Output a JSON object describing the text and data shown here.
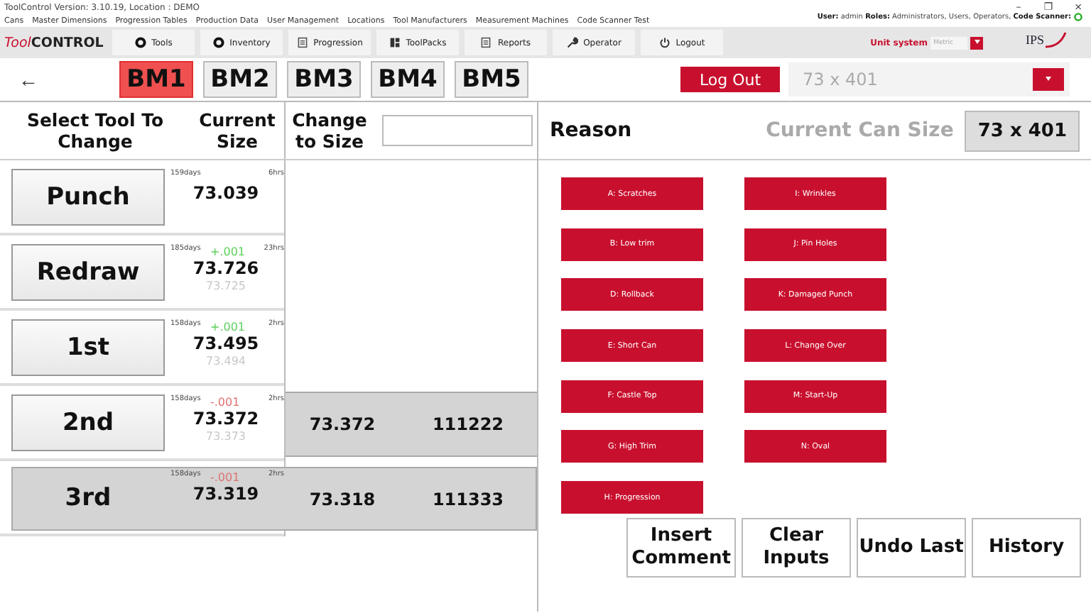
{
  "window": {
    "title": "ToolControl Version: 3.10.19, Location : DEMO",
    "controls": [
      "–",
      "❐",
      "×"
    ]
  },
  "menu": [
    "Cans",
    "Master Dimensions",
    "Progression Tables",
    "Production Data",
    "User Management",
    "Locations",
    "Tool Manufacturers",
    "Measurement Machines",
    "Code Scanner Test"
  ],
  "logo": {
    "text_light": "Tool",
    "text_bold": "CONTROL"
  },
  "toolbar": [
    {
      "label": "Tools",
      "kind": "circle"
    },
    {
      "label": "Inventory",
      "kind": "circle"
    },
    {
      "label": "Progression",
      "kind": "doc"
    },
    {
      "label": "ToolPacks",
      "kind": "pack"
    },
    {
      "label": "Reports",
      "kind": "doc"
    },
    {
      "label": "Operator",
      "kind": "wrench"
    },
    {
      "label": "Logout",
      "kind": "logout"
    }
  ],
  "user_info": {
    "user_label": "User:",
    "user": "admin",
    "roles_label": "Roles:",
    "roles": "Administrators, Users, Operators,",
    "scanner_label": "Code Scanner:",
    "scanner_on": true
  },
  "unit_system": {
    "label": "Unit system",
    "value": "Metric"
  },
  "brand": {
    "text": "IPS"
  },
  "back": "←",
  "machines": [
    {
      "label": "BM1",
      "selected": true
    },
    {
      "label": "BM2",
      "selected": false
    },
    {
      "label": "BM3",
      "selected": false
    },
    {
      "label": "BM4",
      "selected": false
    },
    {
      "label": "BM5",
      "selected": false
    }
  ],
  "logout_button": "Log Out",
  "can_select": {
    "value": "73 x 401"
  },
  "headers": {
    "tool": "Select Tool To Change",
    "size": "Current Size",
    "change": "Change to Size"
  },
  "tools": [
    {
      "name": "Punch",
      "days": "159days",
      "hrs": "6hrs",
      "size": "73.039",
      "selected": false
    },
    {
      "name": "Redraw",
      "days": "185days",
      "hrs": "23hrs",
      "delta": "+.001",
      "color": "#5cd05c",
      "size": "73.726",
      "previous": "73.725",
      "selected": false
    },
    {
      "name": "1st",
      "days": "158days",
      "hrs": "2hrs",
      "delta": "+.001",
      "color": "#5cd05c",
      "size": "73.495",
      "previous": "73.494",
      "selected": false
    },
    {
      "name": "2nd",
      "days": "158days",
      "hrs": "2hrs",
      "delta": "-.001",
      "color": "#e07070",
      "size": "73.372",
      "previous": "73.373",
      "selected": false,
      "change_size": "73.372",
      "change_code": "111222"
    },
    {
      "name": "3rd",
      "days": "158days",
      "hrs": "2hrs",
      "delta": "-.001",
      "color": "#e07070",
      "size": "73.319",
      "selected": true,
      "change_size": "73.318",
      "change_code": "111333"
    }
  ],
  "reason": {
    "title": "Reason",
    "can_size_label": "Current Can Size",
    "can_size": "73 x 401",
    "columns": [
      [
        "A: Scratches",
        "B: Low trim",
        "D: Rollback",
        "E: Short Can",
        "F: Castle Top",
        "G: High Trim",
        "H: Progression"
      ],
      [
        "I: Wrinkles",
        "J: Pin Holes",
        "K: Damaged Punch",
        "L: Change Over",
        "M: Start-Up",
        "N: Oval"
      ]
    ]
  },
  "actions": [
    "Insert Comment",
    "Clear Inputs",
    "Undo Last",
    "History"
  ]
}
